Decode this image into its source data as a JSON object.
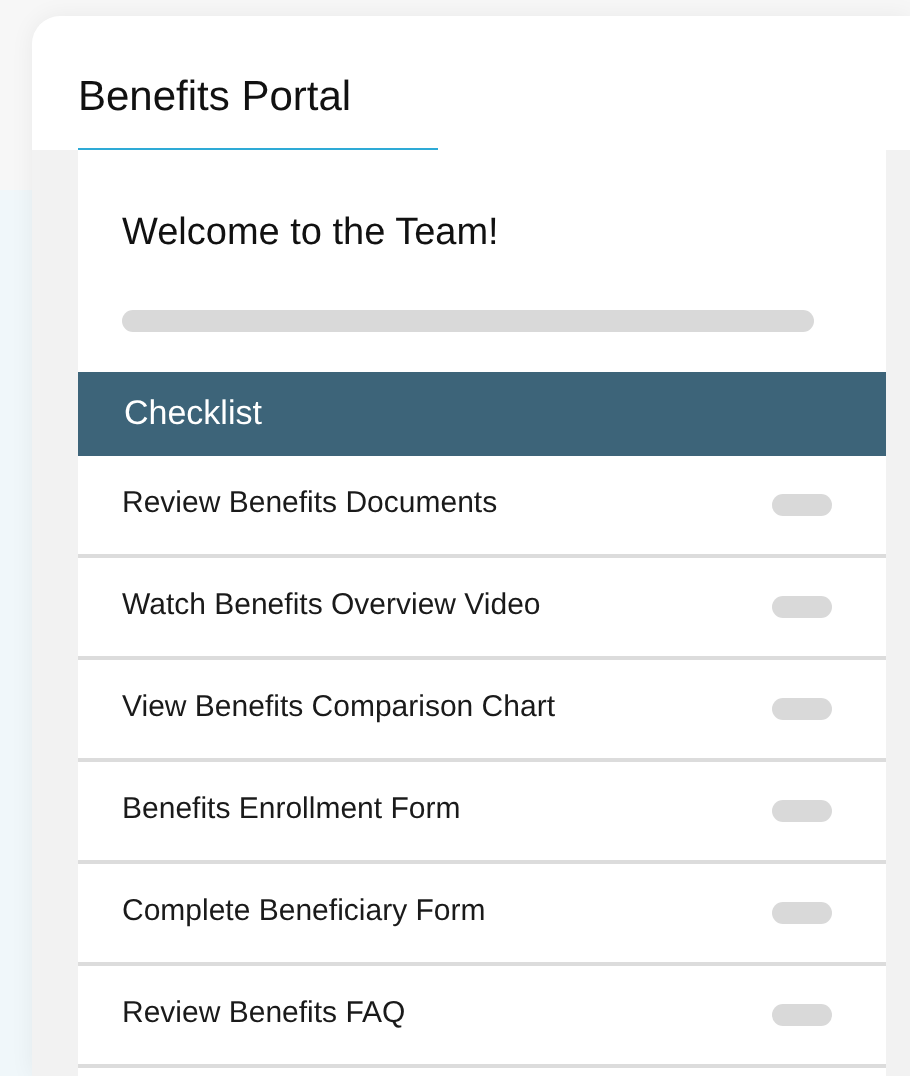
{
  "header": {
    "title": "Benefits Portal"
  },
  "welcome": {
    "title": "Welcome to the Team!",
    "progress": {
      "level": 0
    }
  },
  "checklist": {
    "title": "Checklist",
    "items": [
      {
        "label": "Review Benefits Documents"
      },
      {
        "label": "Watch Benefits Overview Video"
      },
      {
        "label": "View Benefits Comparison Chart"
      },
      {
        "label": "Benefits Enrollment Form"
      },
      {
        "label": "Complete Beneficiary Form"
      },
      {
        "label": "Review Benefits FAQ"
      }
    ]
  }
}
